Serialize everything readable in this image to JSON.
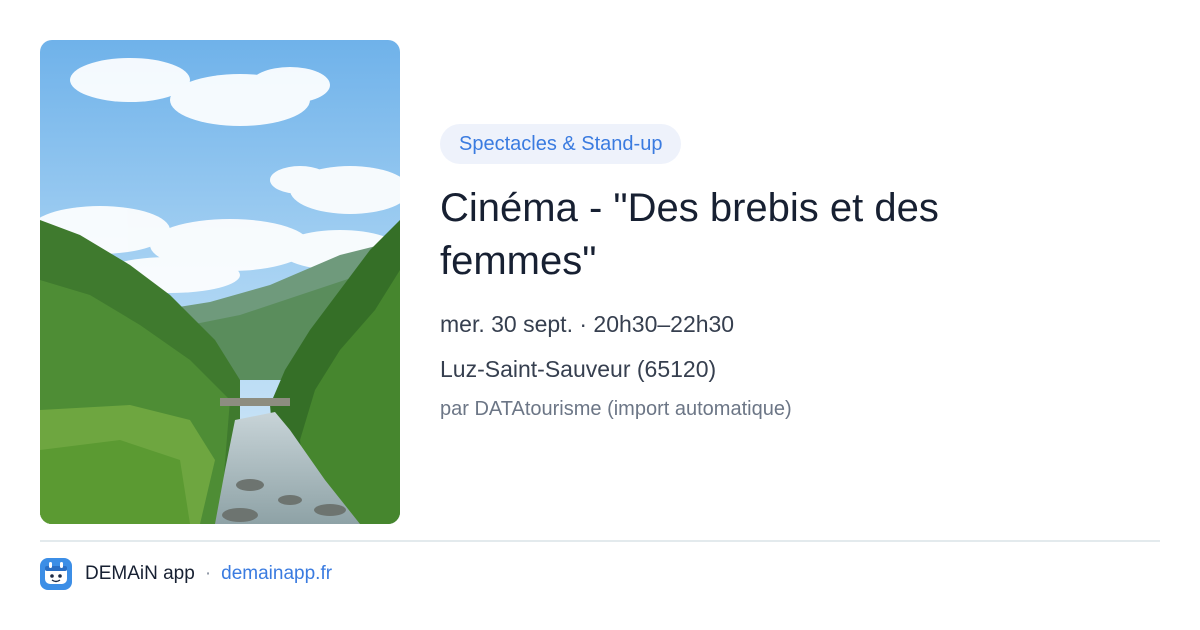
{
  "event": {
    "image_icon": "mountain-river-photo",
    "category": "Spectacles & Stand-up",
    "title": "Cinéma - \"Des brebis et des femmes\"",
    "date_time": "mer. 30 sept. · 20h30–22h30",
    "location": "Luz-Saint-Sauveur (65120)",
    "source": "par DATAtourisme (import automatique)"
  },
  "footer": {
    "app_icon": "demain-app-icon",
    "app_name": "DEMAiN app",
    "separator": "·",
    "link": "demainapp.fr"
  },
  "colors": {
    "accent": "#3a7be0",
    "badge_bg": "#eef2fb",
    "title": "#172032",
    "muted": "#6c7686",
    "divider": "#e3eaed"
  }
}
